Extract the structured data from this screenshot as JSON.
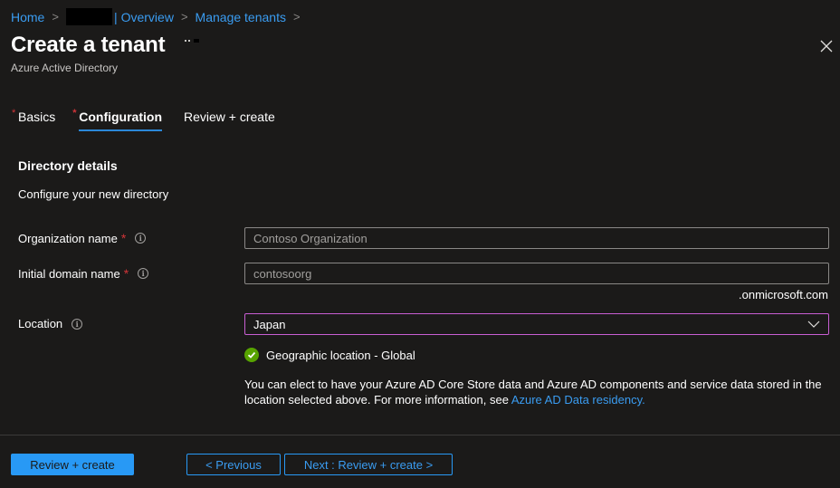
{
  "breadcrumb": {
    "items": [
      "Home",
      "Overview",
      "Manage tenants"
    ],
    "separator": ">",
    "divider": "|"
  },
  "header": {
    "title": "Create a tenant",
    "subtitle": "Azure Active Directory",
    "close_icon": "close-icon",
    "more_icon": "ellipsis-icon"
  },
  "tabs": [
    {
      "label": "Basics",
      "required": true,
      "required_mark": "*",
      "active": false
    },
    {
      "label": "Configuration",
      "required": true,
      "required_mark": "*",
      "active": true
    },
    {
      "label": "Review + create",
      "required": false,
      "active": false
    }
  ],
  "section": {
    "title": "Directory details",
    "description": "Configure your new directory"
  },
  "form": {
    "organization_name": {
      "label": "Organization name",
      "required_mark": "*",
      "value": "Contoso Organization",
      "info_icon": "i"
    },
    "initial_domain_name": {
      "label": "Initial domain name",
      "required_mark": "*",
      "value": "contosoorg",
      "suffix": ".onmicrosoft.com",
      "info_icon": "i"
    },
    "location": {
      "label": "Location",
      "value": "Japan",
      "info_icon": "i"
    }
  },
  "geo_status": {
    "text": "Geographic location - Global",
    "icon": "check-circle-icon",
    "color": "#57a300"
  },
  "info_paragraph": {
    "text": "You can elect to have your Azure AD Core Store data and Azure AD components and service data stored in the location selected above. For more information, see ",
    "link": "Azure AD Data residency."
  },
  "footer": {
    "primary_button": "Review + create",
    "previous_button": "< Previous",
    "next_button": "Next : Review + create >"
  },
  "colors": {
    "background": "#1b1a19",
    "accent": "#2899f5",
    "link": "#3a9cf1",
    "required": "#d13438",
    "focus_border": "#c85ed2"
  }
}
